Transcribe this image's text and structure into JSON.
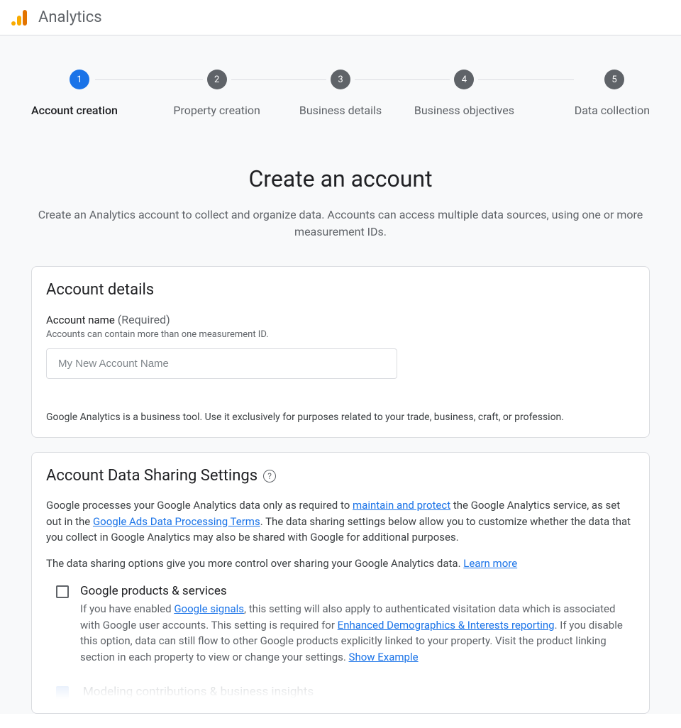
{
  "header": {
    "product": "Analytics"
  },
  "stepper": {
    "steps": [
      {
        "num": "1",
        "label": "Account creation",
        "active": true
      },
      {
        "num": "2",
        "label": "Property creation",
        "active": false
      },
      {
        "num": "3",
        "label": "Business details",
        "active": false
      },
      {
        "num": "4",
        "label": "Business objectives",
        "active": false
      },
      {
        "num": "5",
        "label": "Data collection",
        "active": false
      }
    ]
  },
  "page": {
    "title": "Create an account",
    "subtitle": "Create an Analytics account to collect and organize data. Accounts can access multiple data sources, using one or more measurement IDs."
  },
  "details": {
    "card_title": "Account details",
    "name_label": "Account name",
    "name_required": "(Required)",
    "name_hint": "Accounts can contain more than one measurement ID.",
    "name_placeholder": "My New Account Name",
    "disclaimer": "Google Analytics is a business tool. Use it exclusively for purposes related to your trade, business, craft, or profession."
  },
  "sharing": {
    "title": "Account Data Sharing Settings",
    "desc_pre1": "Google processes your Google Analytics data only as required to ",
    "link1": "maintain and protect",
    "desc_mid1": " the Google Analytics service, as set out in the ",
    "link2": "Google Ads Data Processing Terms",
    "desc_post1": ". The data sharing settings below allow you to customize whether the data that you collect in Google Analytics may also be shared with Google for additional purposes.",
    "desc2_pre": "The data sharing options give you more control over sharing your Google Analytics data. ",
    "learn_more": "Learn more",
    "option1": {
      "title": "Google products & services",
      "d_pre": "If you have enabled ",
      "d_link1": "Google signals",
      "d_mid1": ", this setting will also apply to authenticated visitation data which is associated with Google user accounts. This setting is required for ",
      "d_link2": "Enhanced Demographics & Interests reporting",
      "d_mid2": ". If you disable this option, data can still flow to other Google products explicitly linked to your property. Visit the product linking section in each property to view or change your settings. ",
      "d_link3": "Show Example"
    },
    "option2": {
      "title": "Modeling contributions & business insights"
    }
  }
}
